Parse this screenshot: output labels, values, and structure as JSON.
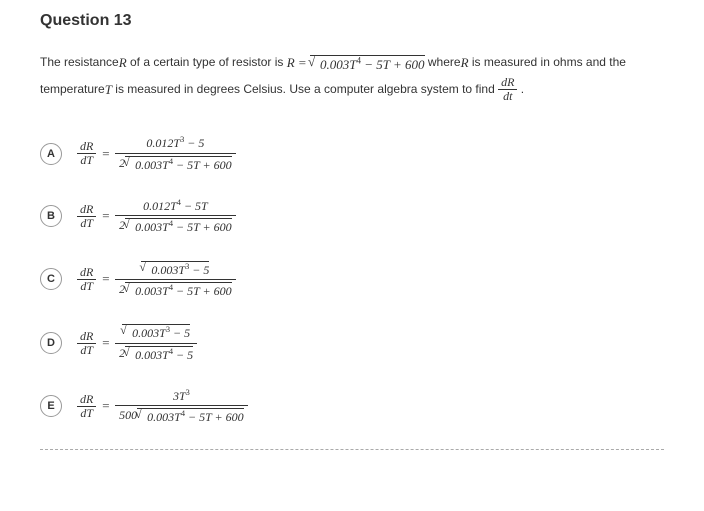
{
  "question": {
    "label": "Question 13",
    "stem_part1": "The resistance",
    "stem_R": "R",
    "stem_part2": " of a certain type of resistor is ",
    "stem_eq_lhs": "R = ",
    "stem_eq_radicand": "0.003T⁴ − 5T + 600",
    "stem_part3": " where",
    "stem_R2": "R",
    "stem_part4": " is measured in ohms and the temperature",
    "stem_T": "T",
    "stem_part5": " is measured in degrees Celsius. Use a computer algebra system to find ",
    "stem_deriv_num": "dR",
    "stem_deriv_den": "dt",
    "stem_part6": " ."
  },
  "options": [
    {
      "letter": "A",
      "lhs_num": "dR",
      "lhs_den": "dT",
      "rhs_num": "0.012T³ − 5",
      "rhs_den_prefix": "2",
      "rhs_den_rad": "0.003T⁴ − 5T + 600",
      "num_has_sqrt": false
    },
    {
      "letter": "B",
      "lhs_num": "dR",
      "lhs_den": "dT",
      "rhs_num": "0.012T⁴ − 5T",
      "rhs_den_prefix": "2",
      "rhs_den_rad": "0.003T⁴ − 5T + 600",
      "num_has_sqrt": false
    },
    {
      "letter": "C",
      "lhs_num": "dR",
      "lhs_den": "dT",
      "rhs_num": "0.003T³ − 5",
      "rhs_den_prefix": "2",
      "rhs_den_rad": "0.003T⁴ − 5T + 600",
      "num_has_sqrt": true
    },
    {
      "letter": "D",
      "lhs_num": "dR",
      "lhs_den": "dT",
      "rhs_num": "0.003T³ − 5",
      "rhs_den_prefix": "2",
      "rhs_den_rad": "0.003T⁴ − 5",
      "num_has_sqrt": true
    },
    {
      "letter": "E",
      "lhs_num": "dR",
      "lhs_den": "dT",
      "rhs_num": "3T³",
      "rhs_den_prefix": "500",
      "rhs_den_rad": "0.003T⁴ − 5T + 600",
      "num_has_sqrt": false
    }
  ]
}
